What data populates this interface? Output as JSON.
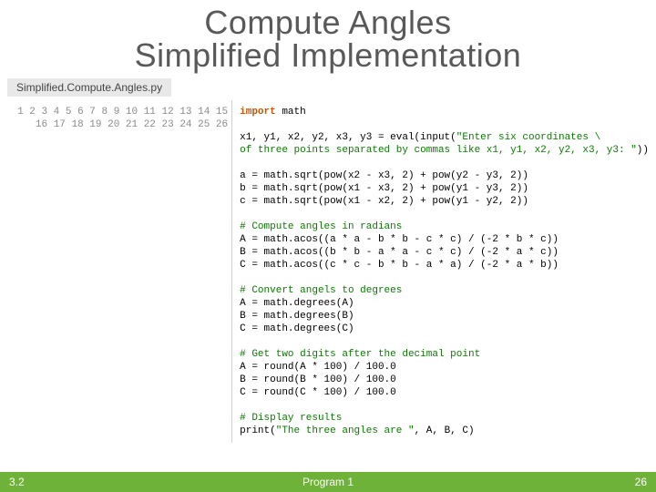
{
  "title": {
    "line1": "Compute Angles",
    "line2": "Simplified Implementation"
  },
  "filename": "Simplified.Compute.Angles.py",
  "gutter": "1\n2\n3\n4\n5\n6\n7\n8\n9\n10\n11\n12\n13\n14\n15\n16\n17\n18\n19\n20\n21\n22\n23\n24\n25\n26",
  "code": {
    "l1a": "import",
    "l1b": " math",
    "l3a": "x1, y1, x2, y2, x3, y3 = eval(input(",
    "l3b": "\"Enter six coordinates \\",
    "l4a": "of three points separated by commas like x1, y1, x2, y2, x3, y3: \"",
    "l4b": "))",
    "l6": "a = math.sqrt(pow(x2 - x3, 2) + pow(y2 - y3, 2))",
    "l7": "b = math.sqrt(pow(x1 - x3, 2) + pow(y1 - y3, 2))",
    "l8": "c = math.sqrt(pow(x1 - x2, 2) + pow(y1 - y2, 2))",
    "l10": "# Compute angles in radians",
    "l11": "A = math.acos((a * a - b * b - c * c) / (-2 * b * c))",
    "l12": "B = math.acos((b * b - a * a - c * c) / (-2 * a * c))",
    "l13": "C = math.acos((c * c - b * b - a * a) / (-2 * a * b))",
    "l15": "# Convert angels to degrees",
    "l16": "A = math.degrees(A)",
    "l17": "B = math.degrees(B)",
    "l18": "C = math.degrees(C)",
    "l20": "# Get two digits after the decimal point",
    "l21": "A = round(A * 100) / 100.0",
    "l22": "B = round(B * 100) / 100.0",
    "l23": "C = round(C * 100) / 100.0",
    "l25": "# Display results",
    "l26a": "print(",
    "l26b": "\"The three angles are \"",
    "l26c": ", A, B, C)"
  },
  "footer": {
    "left": "3.2",
    "center": "Program 1",
    "right": "26"
  }
}
